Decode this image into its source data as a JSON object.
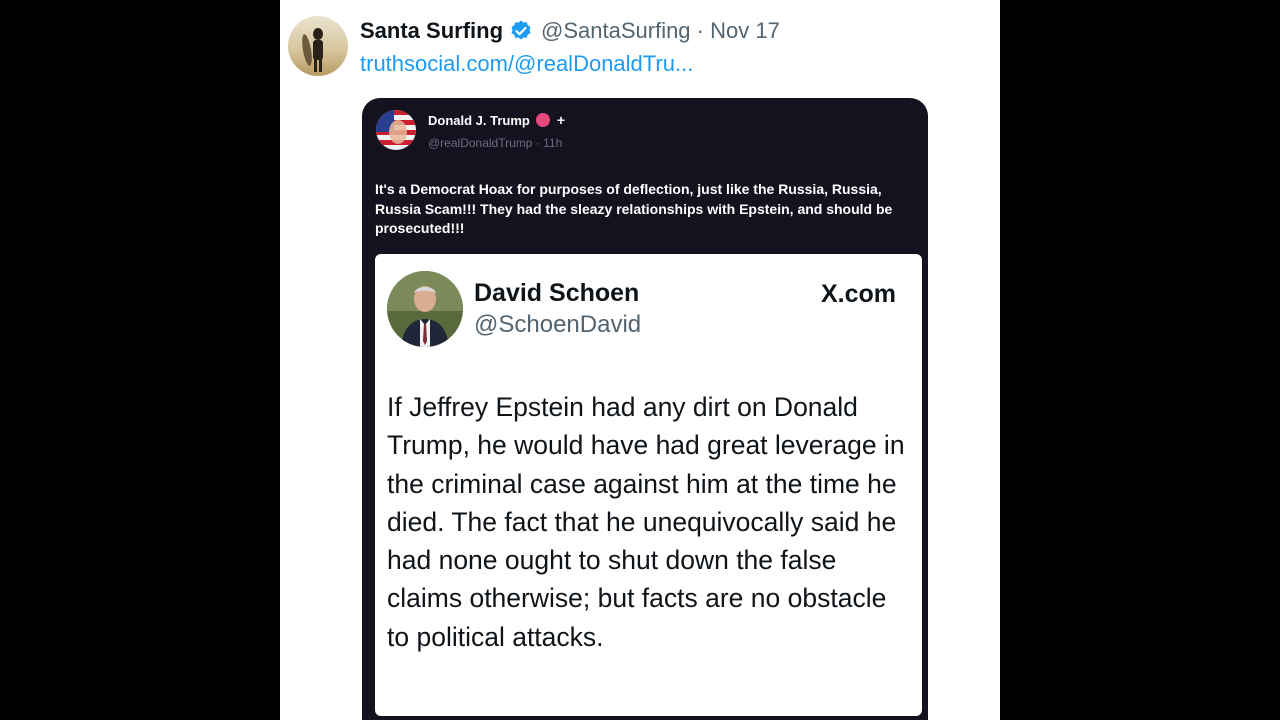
{
  "tweet": {
    "display_name": "Santa Surfing",
    "handle_date": "@SantaSurfing · Nov 17",
    "link": "truthsocial.com/@realDonaldTru...",
    "icons": {
      "avatar": "surfer-avatar",
      "verified": "verified-badge-icon"
    },
    "colors": {
      "link": "#1d9bf0",
      "verified": "#1d9bf0"
    }
  },
  "truth_post": {
    "name": "Donald J. Trump",
    "plus": "+",
    "handle_time": "@realDonaldTrump · 11h",
    "body": "It's a Democrat Hoax for purposes of deflection, just like the Russia, Russia, Russia Scam!!! They had the sleazy relationships with Epstein, and should be prosecuted!!!",
    "colors": {
      "background": "#14121f",
      "badge": "#e6487e"
    }
  },
  "quoted_post": {
    "name": "David Schoen",
    "handle": "@SchoenDavid",
    "source": "X.com",
    "body": "If Jeffrey Epstein had any dirt on Donald Trump, he would have had great leverage in the criminal case against him at the time he died.  The fact that he unequivocally said he had none ought to shut down the false claims otherwise; but facts are no obstacle to political attacks."
  }
}
